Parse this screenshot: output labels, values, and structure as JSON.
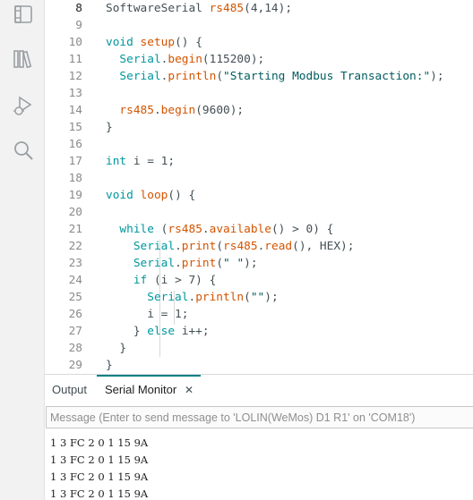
{
  "activity_bar": {
    "icons": [
      "sketchbook-icon",
      "library-manager-icon",
      "debug-icon",
      "search-icon"
    ]
  },
  "editor": {
    "lines": [
      {
        "n": "8",
        "current": true,
        "tokens": [
          [
            "SoftwareSerial ",
            "p"
          ],
          [
            "rs485",
            "fn"
          ],
          [
            "(4,14);",
            "p"
          ]
        ]
      },
      {
        "n": "9",
        "tokens": []
      },
      {
        "n": "10",
        "tokens": [
          [
            "void",
            "kw"
          ],
          [
            " ",
            "p"
          ],
          [
            "setup",
            "fn"
          ],
          [
            "() {",
            "p"
          ]
        ]
      },
      {
        "n": "11",
        "tokens": [
          [
            "  ",
            "p"
          ],
          [
            "Serial",
            "ty"
          ],
          [
            ".",
            "p"
          ],
          [
            "begin",
            "fn"
          ],
          [
            "(115200);",
            "p"
          ]
        ]
      },
      {
        "n": "12",
        "tokens": [
          [
            "  ",
            "p"
          ],
          [
            "Serial",
            "ty"
          ],
          [
            ".",
            "p"
          ],
          [
            "println",
            "fn"
          ],
          [
            "(",
            "p"
          ],
          [
            "\"Starting Modbus Transaction:\"",
            "str"
          ],
          [
            ");",
            "p"
          ]
        ]
      },
      {
        "n": "13",
        "tokens": []
      },
      {
        "n": "14",
        "tokens": [
          [
            "  ",
            "p"
          ],
          [
            "rs485",
            "fn"
          ],
          [
            ".",
            "p"
          ],
          [
            "begin",
            "fn"
          ],
          [
            "(9600);",
            "p"
          ]
        ]
      },
      {
        "n": "15",
        "tokens": [
          [
            "}",
            "p"
          ]
        ]
      },
      {
        "n": "16",
        "tokens": []
      },
      {
        "n": "17",
        "tokens": [
          [
            "int",
            "kw"
          ],
          [
            " i = 1;",
            "p"
          ]
        ]
      },
      {
        "n": "18",
        "tokens": []
      },
      {
        "n": "19",
        "tokens": [
          [
            "void",
            "kw"
          ],
          [
            " ",
            "p"
          ],
          [
            "loop",
            "fn"
          ],
          [
            "() {",
            "p"
          ]
        ]
      },
      {
        "n": "20",
        "tokens": []
      },
      {
        "n": "21",
        "tokens": [
          [
            "  ",
            "p"
          ],
          [
            "while",
            "kw"
          ],
          [
            " (",
            "p"
          ],
          [
            "rs485",
            "fn"
          ],
          [
            ".",
            "p"
          ],
          [
            "available",
            "fn"
          ],
          [
            "() > 0) {",
            "p"
          ]
        ]
      },
      {
        "n": "22",
        "tokens": [
          [
            "    ",
            "p"
          ],
          [
            "Serial",
            "ty"
          ],
          [
            ".",
            "p"
          ],
          [
            "print",
            "fn"
          ],
          [
            "(",
            "p"
          ],
          [
            "rs485",
            "fn"
          ],
          [
            ".",
            "p"
          ],
          [
            "read",
            "fn"
          ],
          [
            "(), HEX);",
            "p"
          ]
        ]
      },
      {
        "n": "23",
        "tokens": [
          [
            "    ",
            "p"
          ],
          [
            "Serial",
            "ty"
          ],
          [
            ".",
            "p"
          ],
          [
            "print",
            "fn"
          ],
          [
            "(",
            "p"
          ],
          [
            "\" \"",
            "str"
          ],
          [
            ");",
            "p"
          ]
        ]
      },
      {
        "n": "24",
        "tokens": [
          [
            "    ",
            "p"
          ],
          [
            "if",
            "kw"
          ],
          [
            " (i > 7) {",
            "p"
          ]
        ]
      },
      {
        "n": "25",
        "tokens": [
          [
            "      ",
            "p"
          ],
          [
            "Serial",
            "ty"
          ],
          [
            ".",
            "p"
          ],
          [
            "println",
            "fn"
          ],
          [
            "(",
            "p"
          ],
          [
            "\"\"",
            "str"
          ],
          [
            ");",
            "p"
          ]
        ]
      },
      {
        "n": "26",
        "tokens": [
          [
            "      i = 1;",
            "p"
          ]
        ]
      },
      {
        "n": "27",
        "tokens": [
          [
            "    } ",
            "p"
          ],
          [
            "else",
            "kw"
          ],
          [
            " i++;",
            "p"
          ]
        ]
      },
      {
        "n": "28",
        "tokens": [
          [
            "  }",
            "p"
          ]
        ]
      },
      {
        "n": "29",
        "tokens": [
          [
            "}",
            "p"
          ]
        ]
      }
    ]
  },
  "panel": {
    "tab_output": "Output",
    "tab_serial": "Serial Monitor",
    "close_glyph": "✕",
    "message_placeholder": "Message (Enter to send message to 'LOLIN(WeMos) D1 R1' on 'COM18')",
    "message_value": "",
    "monitor_lines": [
      "1 3 FC 2 0 1 15 9A",
      "1 3 FC 2 0 1 15 9A",
      "1 3 FC 2 0 1 15 9A",
      "1 3 FC 2 0 1 15 9A"
    ]
  }
}
